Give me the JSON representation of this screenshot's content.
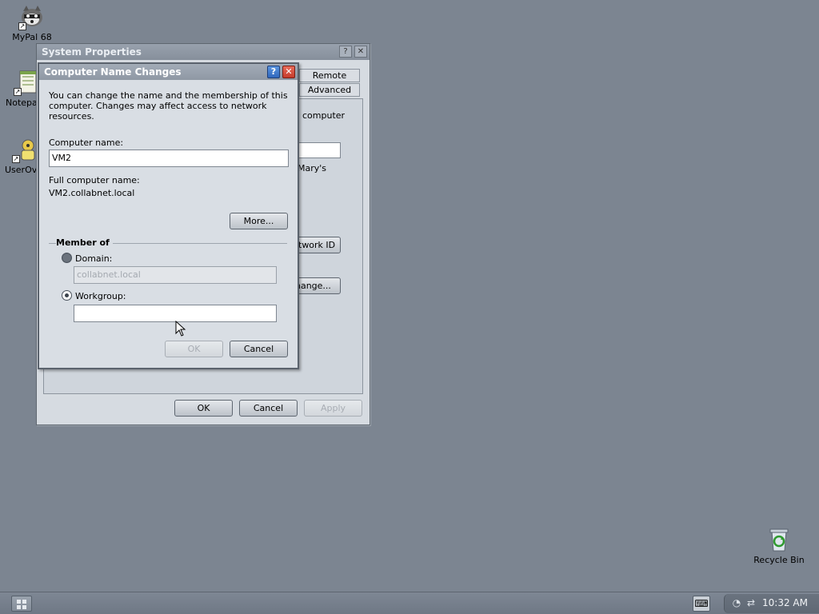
{
  "desktop": {
    "icons": [
      {
        "label": "MyPal 68",
        "icon": "raccoon-icon"
      },
      {
        "label": "Notepa",
        "icon": "notepad-icon"
      },
      {
        "label": "UserOv",
        "icon": "user-overview-icon"
      },
      {
        "label": "Recycle Bin",
        "icon": "recycle-bin-icon"
      }
    ]
  },
  "system_properties": {
    "title": "System Properties",
    "tabs": [
      "Remote",
      "Advanced"
    ],
    "panel_text": {
      "computer": "computer",
      "marys": "Mary's"
    },
    "network_id_button": "twork ID",
    "change_button": "hange...",
    "ok_button": "OK",
    "cancel_button": "Cancel",
    "apply_button": "Apply"
  },
  "dialog": {
    "title": "Computer Name Changes",
    "help_glyph": "?",
    "close_glyph": "✕",
    "intro": "You can change the name and the membership of this computer. Changes may affect access to network resources.",
    "computer_name_label": "Computer name:",
    "computer_name_value": "VM2",
    "full_name_label": "Full computer name:",
    "full_name_value": "VM2.collabnet.local",
    "more_button": "More...",
    "member_of_label": "Member of",
    "domain_label": "Domain:",
    "domain_value": "collabnet.local",
    "workgroup_label": "Workgroup:",
    "workgroup_value": "",
    "ok_button": "OK",
    "cancel_button": "Cancel"
  },
  "taskbar": {
    "clock": "10:32 AM",
    "keyboard_icon": "keyboard-icon",
    "tray_icons": [
      "volume-icon",
      "network-icon"
    ]
  },
  "colors": {
    "desktop": "#7c8591",
    "title_active": "#8f98a4",
    "close_red": "#c53b2b",
    "help_blue": "#2f67bd"
  }
}
